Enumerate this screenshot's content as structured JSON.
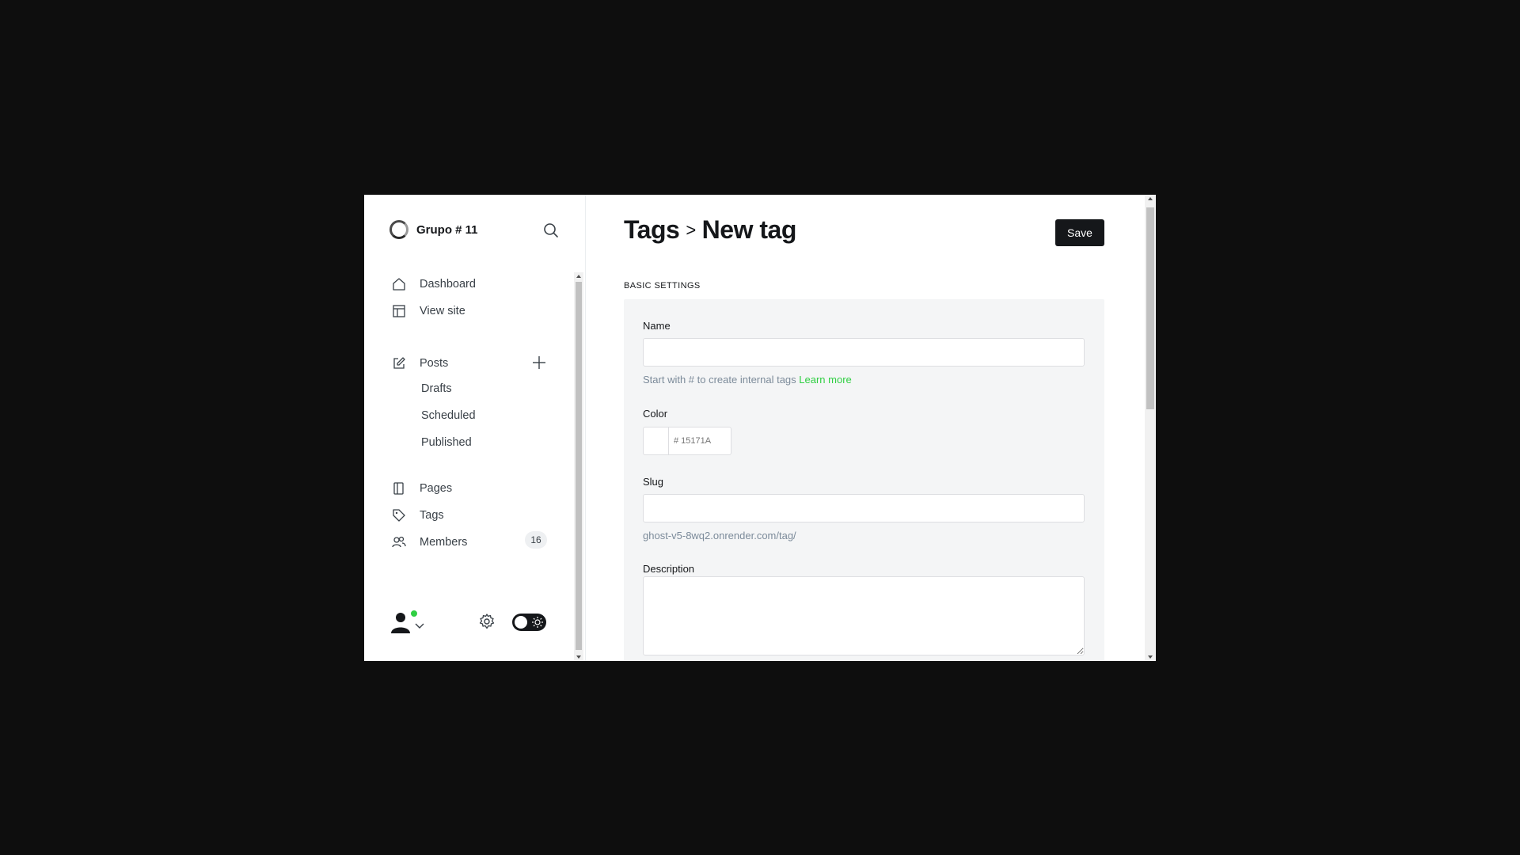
{
  "sidebar": {
    "site_name": "Grupo # 11",
    "nav": [
      {
        "label": "Dashboard",
        "icon": "home-icon"
      },
      {
        "label": "View site",
        "icon": "layout-icon"
      }
    ],
    "posts": {
      "label": "Posts",
      "icon": "edit-icon"
    },
    "post_subitems": [
      "Drafts",
      "Scheduled",
      "Published"
    ],
    "nav2": [
      {
        "label": "Pages",
        "icon": "page-icon"
      },
      {
        "label": "Tags",
        "icon": "tag-icon"
      },
      {
        "label": "Members",
        "icon": "members-icon",
        "count": "16"
      }
    ],
    "user_status_color": "#30cf43"
  },
  "header": {
    "breadcrumb_parent": "Tags",
    "breadcrumb_separator": ">",
    "title": "New tag",
    "save_label": "Save"
  },
  "form": {
    "section_title": "BASIC SETTINGS",
    "name_label": "Name",
    "name_value": "",
    "name_hint": "Start with # to create internal tags",
    "name_hint_link": "Learn more",
    "color_label": "Color",
    "color_placeholder": "# 15171A",
    "slug_label": "Slug",
    "slug_value": "",
    "slug_hint": "ghost-v5-8wq2.onrender.com/tag/",
    "description_label": "Description",
    "description_value": ""
  },
  "colors": {
    "accent": "#30cf43",
    "dark": "#15171a"
  }
}
